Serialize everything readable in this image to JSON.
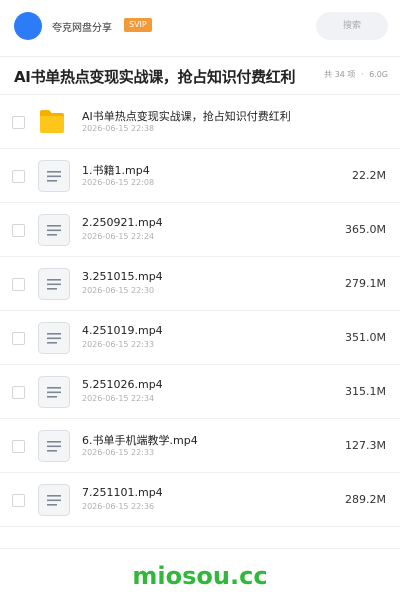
{
  "header": {
    "share_name": "夸克网盘分享",
    "vip_label": "SVIP",
    "search_placeholder": "搜索"
  },
  "title": "AI书单热点变现实战课，抢占知识付费红利",
  "summary": {
    "count": "共 34 项",
    "size": "6.0G"
  },
  "files": [
    {
      "type": "folder",
      "name": "AI书单热点变现实战课，抢占知识付费红利",
      "date": "2026-06-15 22:38",
      "size": ""
    },
    {
      "type": "file",
      "name": "1.书籍1.mp4",
      "date": "2026-06-15 22:08",
      "size": "22.2M"
    },
    {
      "type": "file",
      "name": "2.250921.mp4",
      "date": "2026-06-15 22:24",
      "size": "365.0M"
    },
    {
      "type": "file",
      "name": "3.251015.mp4",
      "date": "2026-06-15 22:30",
      "size": "279.1M"
    },
    {
      "type": "file",
      "name": "4.251019.mp4",
      "date": "2026-06-15 22:33",
      "size": "351.0M"
    },
    {
      "type": "file",
      "name": "5.251026.mp4",
      "date": "2026-06-15 22:34",
      "size": "315.1M"
    },
    {
      "type": "file",
      "name": "6.书单手机端教学.mp4",
      "date": "2026-06-15 22:33",
      "size": "127.3M"
    },
    {
      "type": "file",
      "name": "7.251101.mp4",
      "date": "2026-06-15 22:36",
      "size": "289.2M"
    }
  ],
  "icons": {
    "folder": "folder-icon",
    "file": "document-icon"
  },
  "colors": {
    "avatar": "#2b7cf6",
    "vip": "#f29a38",
    "folder": "#ffc61a",
    "watermark": "#2fb83a"
  },
  "watermark": "miosou.cc"
}
